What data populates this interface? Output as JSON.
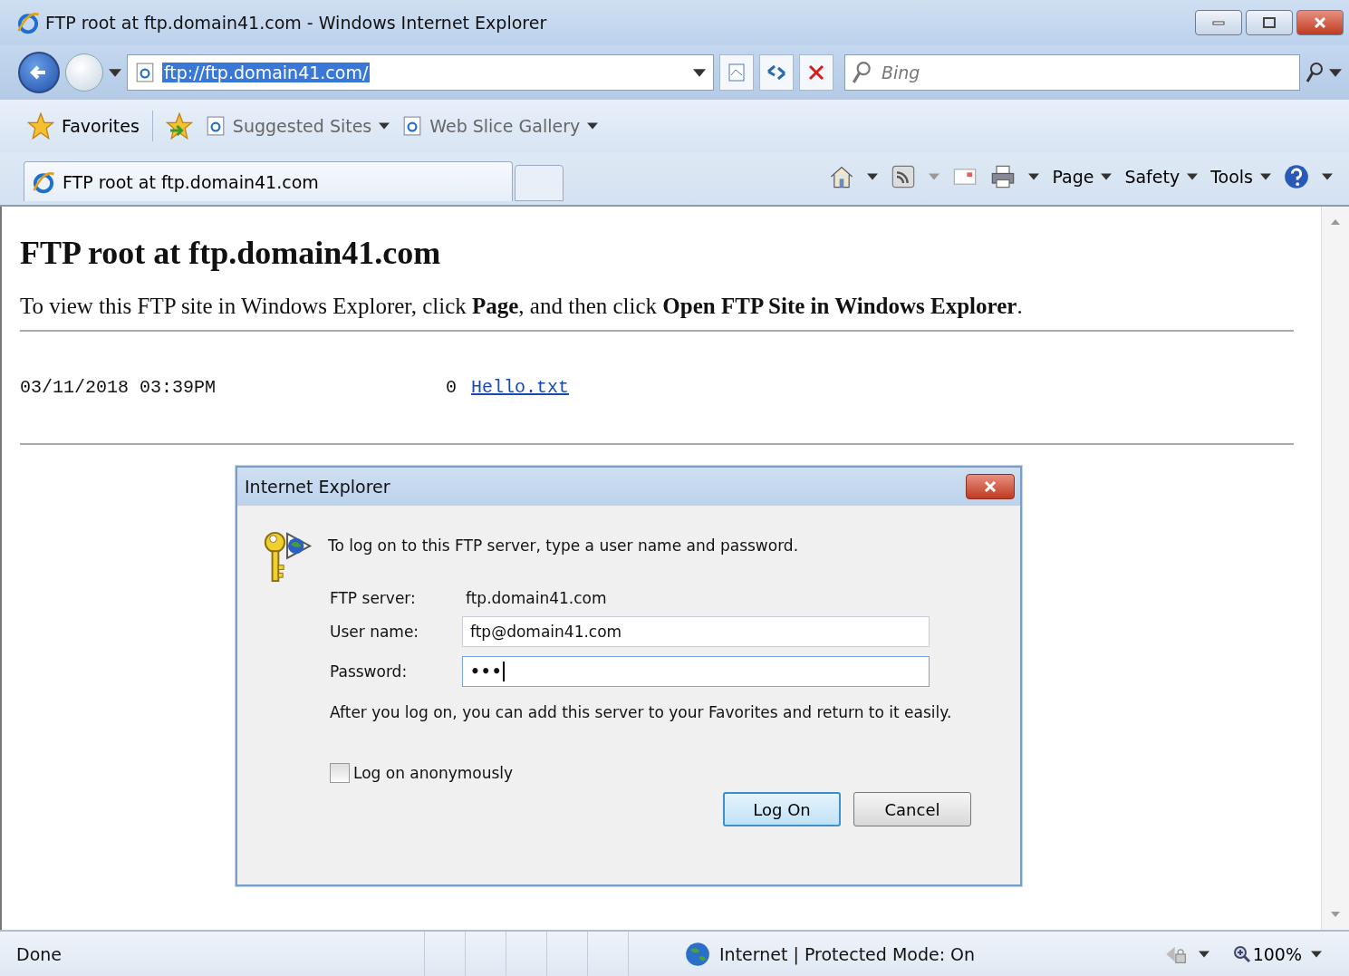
{
  "window": {
    "title": "FTP root at ftp.domain41.com - Windows Internet Explorer"
  },
  "address_bar": {
    "url": "ftp://ftp.domain41.com/",
    "selected": true
  },
  "search": {
    "placeholder": "Bing"
  },
  "favorites_bar": {
    "label": "Favorites",
    "items": [
      "Suggested Sites",
      "Web Slice Gallery"
    ]
  },
  "tabs": [
    {
      "label": "FTP root at ftp.domain41.com",
      "selected": true
    }
  ],
  "command_bar": [
    "Page",
    "Safety",
    "Tools"
  ],
  "page": {
    "heading": "FTP root at ftp.domain41.com",
    "instruction": "To view this FTP site in Windows Explorer, click **Page**, and then click **Open FTP Site in Windows Explorer**.",
    "listing": [
      {
        "date": "03/11/2018 03:39PM",
        "size": "0",
        "name": "Hello.txt"
      }
    ]
  },
  "dialog": {
    "title": "Internet Explorer",
    "message": "To log on to this FTP server, type a user name and password.",
    "fields": [
      {
        "kind": "static",
        "label": "FTP server:",
        "value": "ftp.domain41.com"
      },
      {
        "kind": "text",
        "label": "User name:",
        "value": "ftp@domain41.com"
      },
      {
        "kind": "password",
        "label": "Password:",
        "value": "•••"
      }
    ],
    "note": "After you log on, you can add this server to your Favorites and return to it easily.",
    "checkbox": {
      "label": "Log on anonymously",
      "checked": false
    },
    "buttons": [
      {
        "label": "Log On",
        "default": true
      },
      {
        "label": "Cancel",
        "default": false
      }
    ]
  },
  "status_bar": {
    "text": "Done",
    "zone": "Internet | Protected Mode: On",
    "zoom": "100%"
  }
}
